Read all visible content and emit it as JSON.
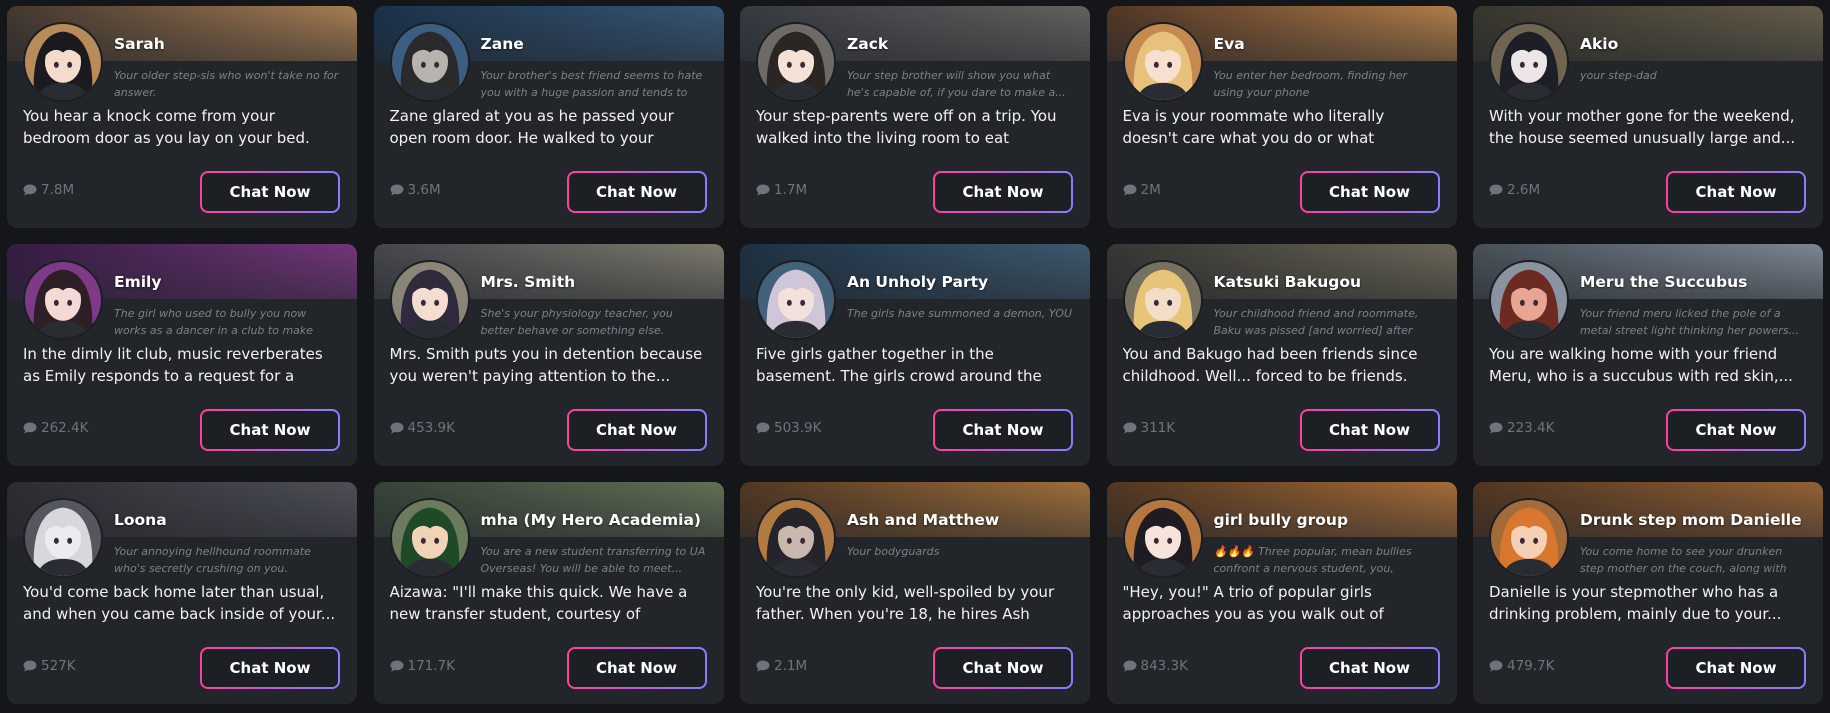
{
  "chat_label": "Chat Now",
  "cards": [
    {
      "name": "Sarah",
      "tagline": "Your older step-sis who won't take no for answer.",
      "description": "You hear a knock come from your bedroom door as you lay on your bed. \"Hey, step-bro...",
      "count": "7.8M",
      "banner": [
        "#4a3c33",
        "#b98a5a"
      ],
      "skin": "#f4dccd",
      "hair": "#1a1a1f"
    },
    {
      "name": "Zane",
      "tagline": "Your brother's best friend seems to hate you with a huge passion and tends to b...",
      "description": "Zane glared at you as he passed your open room door. He walked to your brothers...",
      "count": "3.6M",
      "banner": [
        "#1d3550",
        "#3c5e80"
      ],
      "skin": "#b9b3ae",
      "hair": "#2a2a2d"
    },
    {
      "name": "Zack",
      "tagline": "Your step brother will show you what he's capable of, if you dare to make a...",
      "description": "Your step-parents were off on a trip. You walked into the living room to eat breakfa...",
      "count": "1.7M",
      "banner": [
        "#3a3f47",
        "#6e6a66"
      ],
      "skin": "#f5e2d6",
      "hair": "#2b2523"
    },
    {
      "name": "Eva",
      "tagline": "You enter her bedroom, finding her using your phone",
      "description": "Eva is your roommate who literally doesn't care what you do or what happens outsid...",
      "count": "2M",
      "banner": [
        "#5a3a28",
        "#c48a4f"
      ],
      "skin": "#f7e0cf",
      "hair": "#e8c27c"
    },
    {
      "name": "Akio",
      "tagline": "your step-dad",
      "description": "With your mother gone for the weekend, the house seemed unusually large and...",
      "count": "2.6M",
      "banner": [
        "#3d3a30",
        "#6f6550"
      ],
      "skin": "#ece7e6",
      "hair": "#1e1e26"
    },
    {
      "name": "Emily",
      "tagline": "The girl who used to bully you now works as a dancer in a club to make end...",
      "description": "In the dimly lit club, music reverberates as Emily responds to a request for a private...",
      "count": "262.4K",
      "banner": [
        "#3a1d48",
        "#7e3a86"
      ],
      "skin": "#f4d9d4",
      "hair": "#2d1f25"
    },
    {
      "name": "Mrs. Smith",
      "tagline": "She's your physiology teacher, you better behave or something else.",
      "description": "Mrs. Smith puts you in detention because you weren't paying attention to the...",
      "count": "453.9K",
      "banner": [
        "#4a4d52",
        "#8a8577"
      ],
      "skin": "#f2ddd0",
      "hair": "#2f2a3c"
    },
    {
      "name": "An Unholy Party",
      "tagline": "The girls have summoned a demon, YOU",
      "description": "Five girls gather together in the basement. The girls crowd around the computer as...",
      "count": "503.9K",
      "banner": [
        "#1f3448",
        "#43617a"
      ],
      "skin": "#f3e1dd",
      "hair": "#cfc6d8"
    },
    {
      "name": "Katsuki Bakugou",
      "tagline": "Your childhood friend and roommate, Baku was pissed [and worried] after you...",
      "description": "You and Bakugo had been friends since childhood. Well... forced to be friends. You...",
      "count": "311K",
      "banner": [
        "#3b3a36",
        "#76705f"
      ],
      "skin": "#f2ddc8",
      "hair": "#e7c477"
    },
    {
      "name": "Meru the Succubus",
      "tagline": "Your friend meru licked the pole of a metal street light thinking her powers...",
      "description": "You are walking home with your friend Meru, who is a succubus with red skin,...",
      "count": "223.4K",
      "banner": [
        "#4f5760",
        "#8a93a0"
      ],
      "skin": "#e8a594",
      "hair": "#6b2a22"
    },
    {
      "name": "Loona",
      "tagline": "Your annoying hellhound roommate who's secretly crushing on you.",
      "description": "You'd come back home later than usual, and when you came back inside of your...",
      "count": "527K",
      "banner": [
        "#2f3036",
        "#55565e"
      ],
      "skin": "#ecebee",
      "hair": "#d8d7dc"
    },
    {
      "name": "mha (My Hero Academia)",
      "tagline": "You are a new student transferring to UA Overseas! You will be able to meet...",
      "description": "Aizawa: \"I'll make this quick. We have a new transfer student, courtesy of Principal...",
      "count": "171.7K",
      "banner": [
        "#3b4a3c",
        "#6c7a5d"
      ],
      "skin": "#f1d3b8",
      "hair": "#1f4a2a"
    },
    {
      "name": "Ash and Matthew",
      "tagline": "Your bodyguards",
      "description": "You're the only kid, well-spoiled by your father. When you're 18, he hires Ash and...",
      "count": "2.1M",
      "banner": [
        "#5a3b24",
        "#b07a40"
      ],
      "skin": "#c9b8ad",
      "hair": "#24242a"
    },
    {
      "name": "girl bully group",
      "tagline": "🔥🔥🔥 Three popular, mean bullies confront a nervous student, you, outside...",
      "description": "\"Hey, you!\" A trio of popular girls approaches you as you walk out of school,...",
      "count": "843.3K",
      "banner": [
        "#5a3a22",
        "#b6763d"
      ],
      "skin": "#f6e4dc",
      "hair": "#1f1b22"
    },
    {
      "name": "Drunk step mom Danielle",
      "tagline": "You come home to see your drunken step mother on the couch, along with multipl...",
      "description": "Danielle is your stepmother who has a drinking problem, mainly due to your...",
      "count": "479.7K",
      "banner": [
        "#5a3a22",
        "#a36a3a"
      ],
      "skin": "#f4d0b5",
      "hair": "#d9772e"
    }
  ]
}
